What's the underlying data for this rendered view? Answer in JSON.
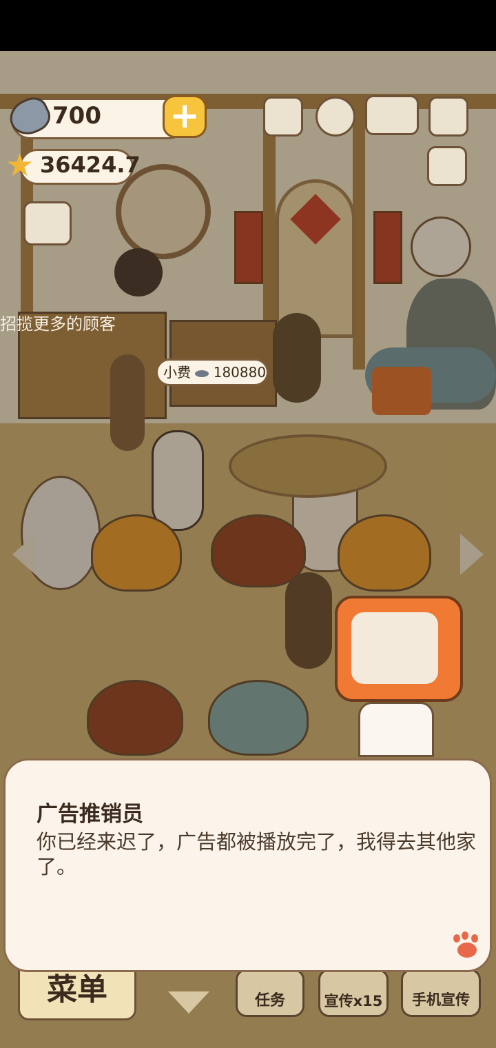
{
  "hud": {
    "fish_count": "700",
    "star_count": "36424.7"
  },
  "scene": {
    "tip_bubble": "小费",
    "tip_value": "180880",
    "banner_text": "招揽更多的顾客"
  },
  "dialog": {
    "speaker": "广告推销员",
    "message": "你已经来迟了，广告都被播放完了，我得去其他家了。"
  },
  "bottom_bar": {
    "menu_label": "菜单",
    "task_label": "任务",
    "promo_label": "宣传x15",
    "phone_promo_label": "手机宣传"
  },
  "colors": {
    "accent_orange": "#f07a34",
    "plus_yellow": "#f7c43d",
    "dialog_bg": "#fcf4ea"
  },
  "icons": [
    "fish-icon",
    "plus-icon",
    "star-icon",
    "leaderboard-icon",
    "settings-gear-icon",
    "recipe-book-icon",
    "camera-icon",
    "newspaper-icon",
    "shop-icon",
    "paw-icon",
    "arrow-left-icon",
    "arrow-right-icon",
    "chevron-down-icon"
  ]
}
